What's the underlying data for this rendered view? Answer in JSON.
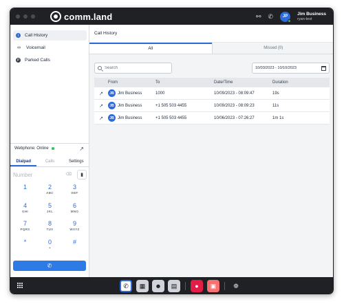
{
  "app": {
    "brand": "comm.land"
  },
  "user": {
    "initials": "JP",
    "name": "Jim Business",
    "subtitle": "ryan-test"
  },
  "sidebar": {
    "items": [
      {
        "label": "Call History",
        "icon": "info-icon"
      },
      {
        "label": "Voicemail",
        "icon": "voicemail-icon"
      },
      {
        "label": "Parked Calls",
        "icon": "parking-icon"
      }
    ]
  },
  "webphone": {
    "status": "Webphone: Online",
    "tabs": [
      "Dialpad",
      "Calls",
      "Settings"
    ],
    "number_placeholder": "Number",
    "keys": [
      {
        "digit": "1",
        "letters": ""
      },
      {
        "digit": "2",
        "letters": "ABC"
      },
      {
        "digit": "3",
        "letters": "DEF"
      },
      {
        "digit": "4",
        "letters": "GHI"
      },
      {
        "digit": "5",
        "letters": "JKL"
      },
      {
        "digit": "6",
        "letters": "MNO"
      },
      {
        "digit": "7",
        "letters": "PQRS"
      },
      {
        "digit": "8",
        "letters": "TUV"
      },
      {
        "digit": "9",
        "letters": "WXYZ"
      },
      {
        "digit": "*",
        "letters": ""
      },
      {
        "digit": "0",
        "letters": "+"
      },
      {
        "digit": "#",
        "letters": ""
      }
    ]
  },
  "main": {
    "title": "Call History",
    "tabs": [
      "All",
      "Missed (0)"
    ],
    "search_placeholder": "Search",
    "date_range": "10/03/2023 - 10/10/2023",
    "columns": [
      "From",
      "To",
      "Date/Time",
      "Duration"
    ],
    "rows": [
      {
        "initials": "JB",
        "from": "Jim Business",
        "to": "1000",
        "datetime": "10/09/2023 - 08:09:47",
        "duration": "19s"
      },
      {
        "initials": "JB",
        "from": "Jim Business",
        "to": "+1 505 503 4455",
        "datetime": "10/09/2023 - 08:09:23",
        "duration": "11s"
      },
      {
        "initials": "JB",
        "from": "Jim Business",
        "to": "+1 505 503 4455",
        "datetime": "10/06/2023 - 07:26:27",
        "duration": "1m 1s"
      }
    ]
  },
  "colors": {
    "accent": "#2e6bd8",
    "titlebar": "#1f2125",
    "online": "#22c55e",
    "call_button": "#2e7be6"
  }
}
